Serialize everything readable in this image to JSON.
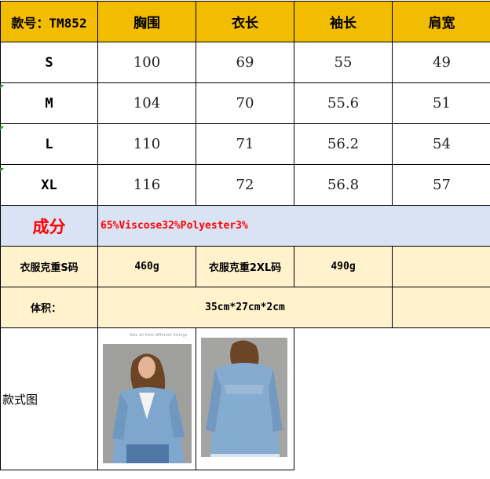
{
  "header": {
    "model_label": "款号：TM852",
    "columns": [
      "胸围",
      "衣长",
      "袖长",
      "肩宽"
    ]
  },
  "sizes": [
    {
      "size": "S",
      "values": [
        "100",
        "69",
        "55",
        "49"
      ]
    },
    {
      "size": "M",
      "values": [
        "104",
        "70",
        "55.6",
        "51"
      ]
    },
    {
      "size": "L",
      "values": [
        "110",
        "71",
        "56.2",
        "54"
      ]
    },
    {
      "size": "XL",
      "values": [
        "116",
        "72",
        "56.8",
        "57"
      ]
    }
  ],
  "composition": {
    "label": "成分",
    "value": "65%Viscose32%Polyester3%"
  },
  "weight": {
    "s_label": "衣服克重S码",
    "s_value": "460g",
    "xxl_label": "衣服克重2XL码",
    "xxl_value": "490g"
  },
  "volume": {
    "label": "体积：",
    "value": "35cm*27cm*2cm"
  },
  "style": {
    "label": "款式图",
    "caption": "Also all from different listings"
  },
  "colors": {
    "header_bg": "#f2bd00",
    "composition_bg": "#dae3f3",
    "composition_text": "#ff0000",
    "weight_bg": "#fff2cc",
    "denim": "#7fa6cc"
  }
}
